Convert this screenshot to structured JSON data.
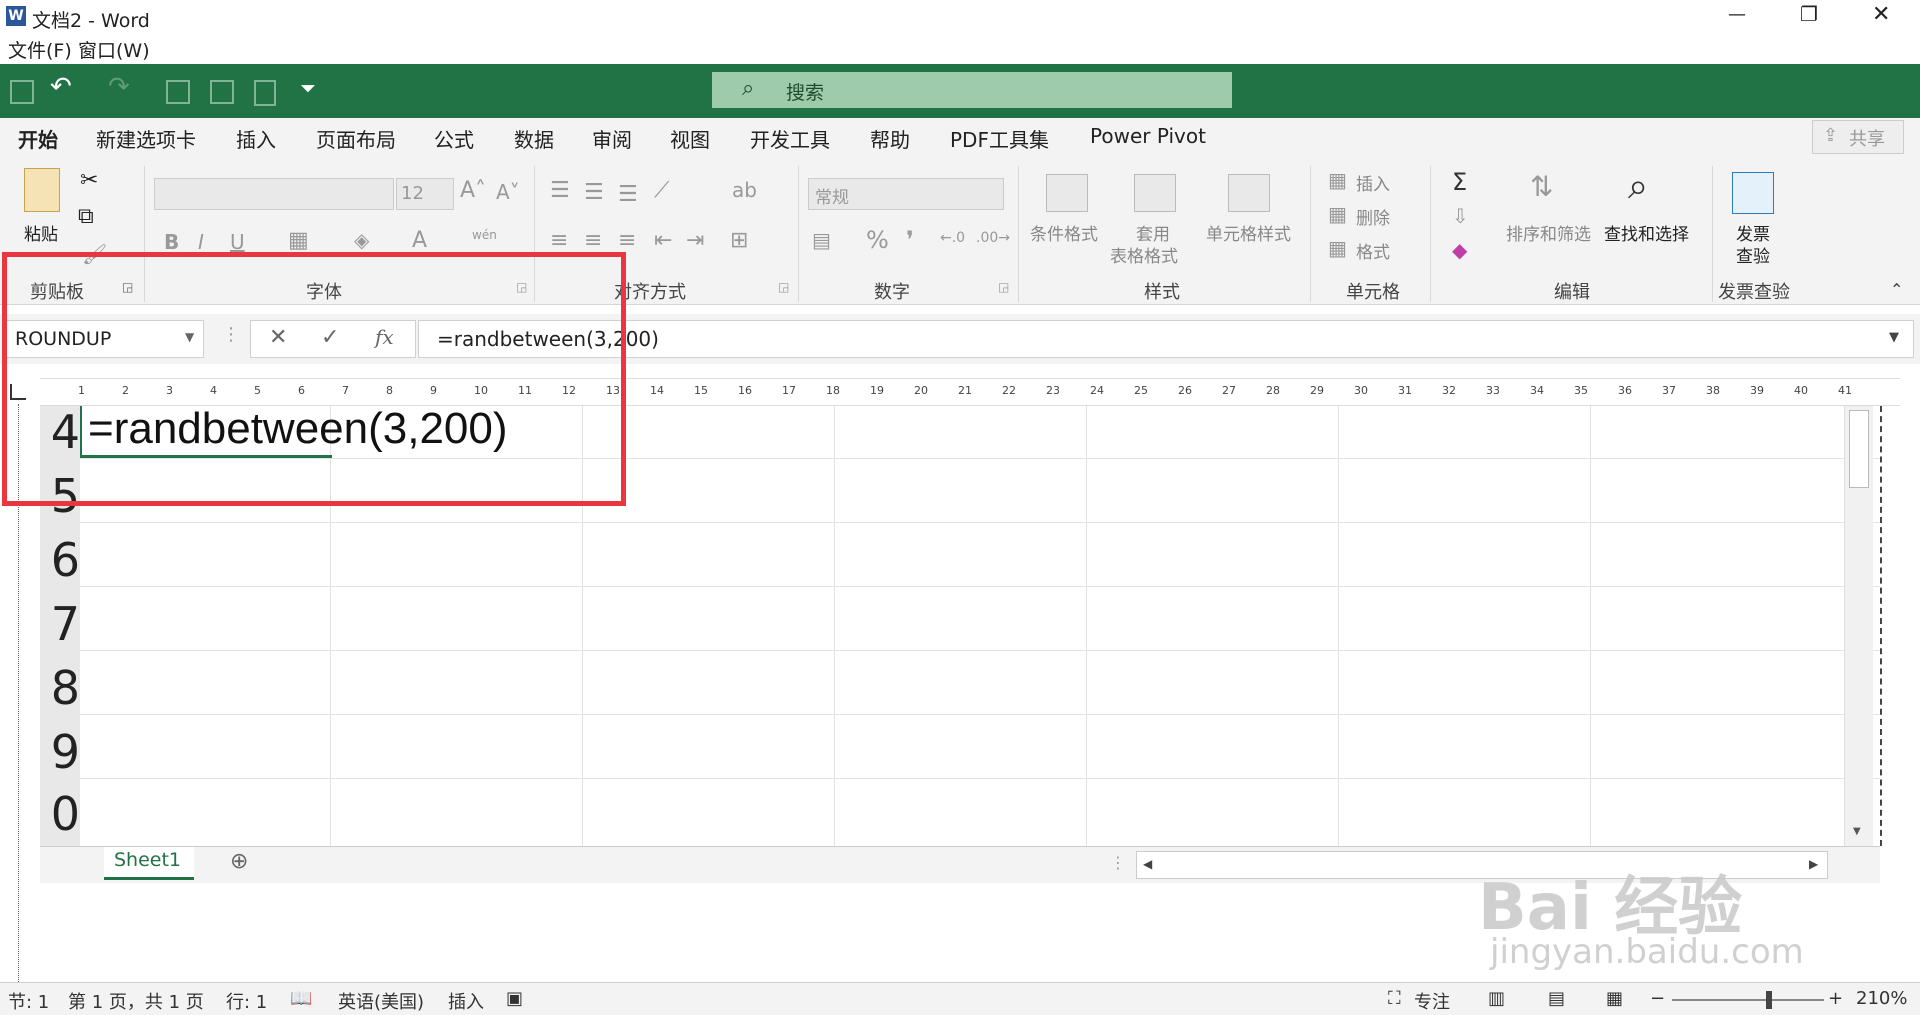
{
  "window": {
    "app_icon": "word-icon",
    "title": "文档2 - Word",
    "controls": {
      "minimize": "—",
      "restore": "❐",
      "close": "✕"
    }
  },
  "menu": {
    "file": "文件(F)",
    "window": "窗口(W)"
  },
  "search": {
    "placeholder": "搜索"
  },
  "tabs": [
    "开始",
    "新建选项卡",
    "插入",
    "页面布局",
    "公式",
    "数据",
    "审阅",
    "视图",
    "开发工具",
    "帮助",
    "PDF工具集",
    "Power Pivot"
  ],
  "share_label": "共享",
  "ribbon": {
    "clipboard": {
      "paste": "粘贴",
      "group": "剪贴板"
    },
    "font": {
      "size": "12",
      "group": "字体",
      "wen": "wén"
    },
    "alignment": {
      "group": "对齐方式"
    },
    "number": {
      "format": "常规",
      "group": "数字"
    },
    "styles": {
      "conditional": "条件格式",
      "table_line1": "套用",
      "table_line2": "表格格式",
      "cell_styles": "单元格样式",
      "group": "样式"
    },
    "cells": {
      "insert": "插入",
      "delete": "删除",
      "format": "格式",
      "group": "单元格"
    },
    "editing": {
      "sort": "排序和筛选",
      "find": "查找和选择",
      "group": "编辑"
    },
    "invoice": {
      "line1": "发票",
      "line2": "查验",
      "group": "发票查验"
    }
  },
  "formula_bar": {
    "name_box": "ROUNDUP",
    "cancel": "✕",
    "enter": "✓",
    "fx": "fx",
    "formula": "=randbetween(3,200)"
  },
  "ruler": {
    "ticks": [
      1,
      2,
      3,
      4,
      5,
      6,
      7,
      8,
      9,
      10,
      11,
      12,
      13,
      14,
      15,
      16,
      17,
      18,
      19,
      20,
      21,
      22,
      23,
      24,
      25,
      26,
      27,
      28,
      29,
      30,
      31,
      32,
      33,
      34,
      35,
      36,
      37,
      38,
      39,
      40,
      41
    ]
  },
  "sheet": {
    "active_cell_text": "=randbetween(3,200)",
    "row_numbers": [
      "4",
      "5",
      "6",
      "7",
      "8",
      "9",
      "0"
    ],
    "tab_name": "Sheet1"
  },
  "status": {
    "section": "节: 1",
    "page": "第 1 页，共 1 页",
    "line": "行: 1",
    "language": "英语(美国)",
    "mode": "插入",
    "focus": "专注",
    "zoom": "210%"
  },
  "watermark": {
    "text": "Bai 经验",
    "url": "jingyan.baidu.com"
  },
  "colors": {
    "excel_green": "#217346",
    "highlight_red": "#e8373e",
    "search_bg": "#9fcbad"
  }
}
